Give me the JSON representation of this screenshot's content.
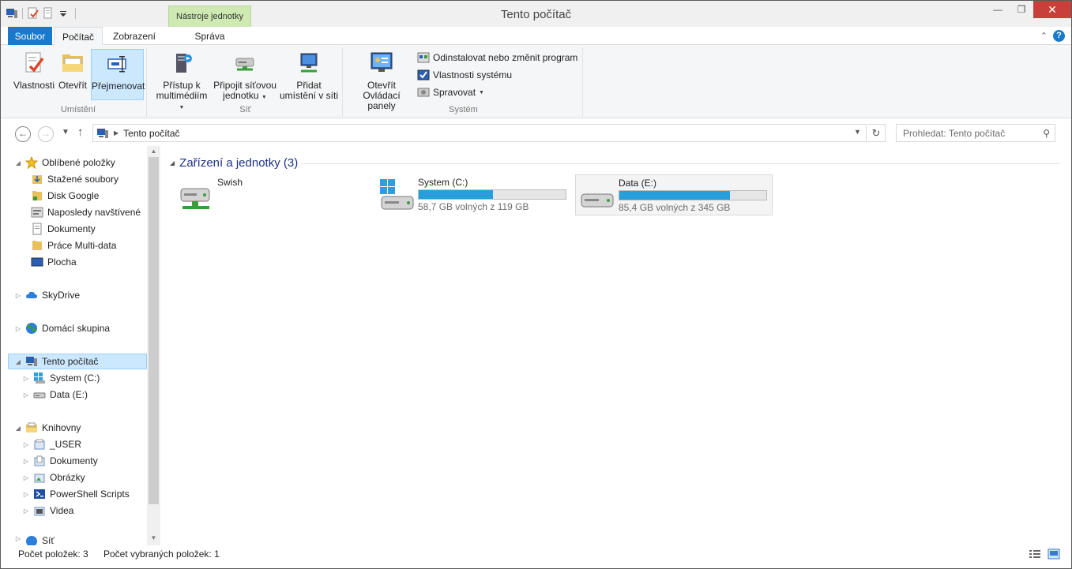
{
  "window": {
    "title": "Tento počítač"
  },
  "ribbon": {
    "contextual_tab": "Nástroje jednotky",
    "tabs": {
      "file": "Soubor",
      "computer": "Počítač",
      "view": "Zobrazení",
      "manage": "Správa"
    },
    "groups": {
      "location": {
        "label": "Umístění",
        "buttons": {
          "properties": "Vlastnosti",
          "open": "Otevřít",
          "rename": "Přejmenovat"
        }
      },
      "network": {
        "label": "Síť",
        "buttons": {
          "media_line1": "Přístup k",
          "media_line2": "multimédiím",
          "map_line1": "Připojit síťovou",
          "map_line2": "jednotku",
          "add_line1": "Přidat",
          "add_line2": "umístění v síti"
        }
      },
      "system": {
        "label": "Systém",
        "buttons": {
          "control_line1": "Otevřít Ovládací",
          "control_line2": "panely",
          "uninstall": "Odinstalovat nebo změnit program",
          "sysprops": "Vlastnosti systému",
          "manage": "Spravovat"
        }
      }
    }
  },
  "address": {
    "path": "Tento počítač",
    "search_placeholder": "Prohledat: Tento počítač"
  },
  "nav": {
    "favorites": "Oblíbené položky",
    "fav_items": [
      "Stažené soubory",
      "Disk Google",
      "Naposledy navštívené",
      "Dokumenty",
      "Práce Multi-data",
      "Plocha"
    ],
    "skydrive": "SkyDrive",
    "homegroup": "Domácí skupina",
    "this_pc": "Tento počítač",
    "pc_items": [
      "System (C:)",
      "Data (E:)"
    ],
    "libraries": "Knihovny",
    "lib_items": [
      "_USER",
      "Dokumenty",
      "Obrázky",
      "PowerShell Scripts",
      "Videa"
    ],
    "network": "Síť"
  },
  "content": {
    "group_title": "Zařízení a jednotky (3)",
    "drives": [
      {
        "name": "Swish"
      },
      {
        "name": "System (C:)",
        "free": "58,7 GB volných z 119 GB",
        "used_fraction": 0.507
      },
      {
        "name": "Data (E:)",
        "free": "85,4 GB volných z 345 GB",
        "used_fraction": 0.752
      }
    ]
  },
  "status": {
    "count": "Počet položek: 3",
    "selected": "Počet vybraných položek: 1"
  },
  "colors": {
    "accent": "#1979ca",
    "selection": "#cce8ff",
    "drive_bar": "#26a0da",
    "contextual": "#cfe9b2"
  }
}
